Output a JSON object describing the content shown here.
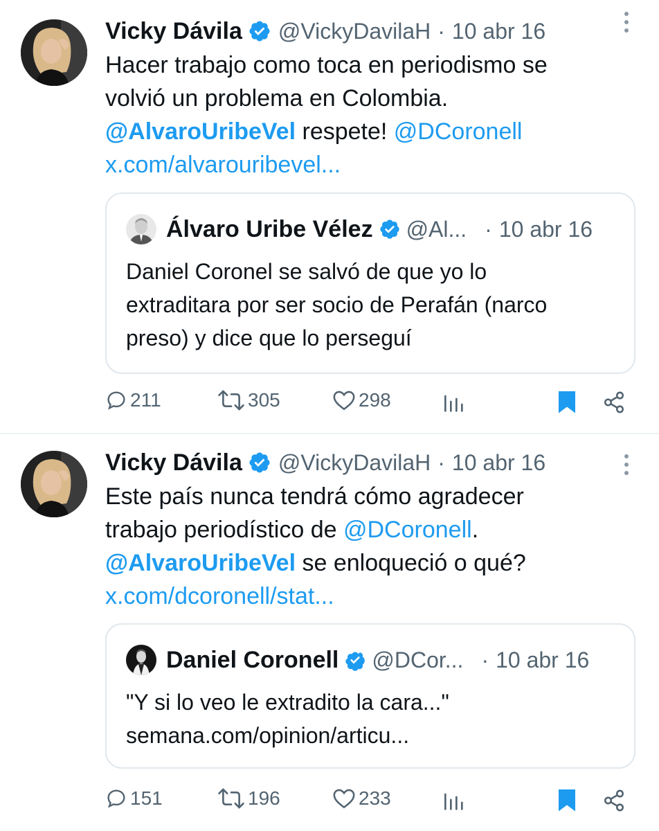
{
  "tweets": [
    {
      "author": {
        "name": "Vicky Dávila",
        "handle": "@VickyDavilaH",
        "avatar": "woman-avatar"
      },
      "separator": "·",
      "date": "10 abr 16",
      "text_line1": "Hacer trabajo como toca en periodismo se",
      "text_line2": "volvió un problema en Colombia.",
      "mention1": "@AlvaroUribeVel",
      "text_mid": " respete! ",
      "mention2": "@DCoronell",
      "link": "x.com/alvarouribevel...",
      "quote": {
        "author": {
          "name": "Álvaro Uribe Vélez",
          "handle": "@Al...",
          "avatar": "man-avatar"
        },
        "separator": "·",
        "date": "10 abr 16",
        "text_line1": "Daniel Coronel se salvó de que yo lo",
        "text_line2": "extraditara por ser socio de Perafán (narco",
        "text_line3": "preso) y dice que lo perseguí"
      },
      "actions": {
        "replies": "211",
        "retweets": "305",
        "likes": "298"
      }
    },
    {
      "author": {
        "name": "Vicky Dávila",
        "handle": "@VickyDavilaH",
        "avatar": "woman-avatar"
      },
      "separator": "·",
      "date": "10 abr 16",
      "text_line1": "Este país nunca tendrá cómo agradecer",
      "text_line2_prefix": "trabajo periodístico de ",
      "mention_inline": "@DCoronell",
      "text_line2_suffix": ".",
      "mention1": "@AlvaroUribeVel",
      "text_mid": " se enloqueció o qué?",
      "link": "x.com/dcoronell/stat...",
      "quote": {
        "author": {
          "name": "Daniel Coronell",
          "handle": "@DCor...",
          "avatar": "man-avatar-2"
        },
        "separator": "·",
        "date": "10 abr 16",
        "text_line1": "\"Y si lo veo le extradito la cara...\"",
        "text_line2": "semana.com/opinion/articu..."
      },
      "actions": {
        "replies": "151",
        "retweets": "196",
        "likes": "233"
      }
    }
  ],
  "colors": {
    "accent": "#1d9bf0",
    "muted": "#536471",
    "text": "#0f1419",
    "border": "#e1e8ed"
  }
}
